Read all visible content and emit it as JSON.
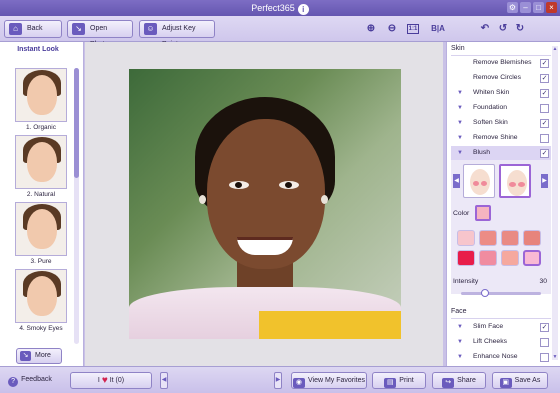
{
  "app": {
    "title": "Perfect365"
  },
  "toolbar": {
    "back_label": "Back",
    "open_label": "Open Photo",
    "adjust_label": "Adjust Key Points",
    "ba_label": "B|A"
  },
  "left_panel": {
    "title": "Instant Look",
    "looks": [
      {
        "label": "1. Organic"
      },
      {
        "label": "2. Natural"
      },
      {
        "label": "3. Pure"
      },
      {
        "label": "4. Smoky Eyes"
      }
    ],
    "more_label": "More"
  },
  "right_panel": {
    "skin_title": "Skin",
    "skin_items": [
      {
        "label": "Remove Blemishes",
        "checked": true,
        "expandable": false
      },
      {
        "label": "Remove Circles",
        "checked": true,
        "expandable": false
      },
      {
        "label": "Whiten Skin",
        "checked": true,
        "expandable": true
      },
      {
        "label": "Foundation",
        "checked": false,
        "expandable": true
      },
      {
        "label": "Soften Skin",
        "checked": true,
        "expandable": true
      },
      {
        "label": "Remove Shine",
        "checked": false,
        "expandable": true
      },
      {
        "label": "Blush",
        "checked": true,
        "expandable": true
      }
    ],
    "blush": {
      "color_label": "Color",
      "intensity_label": "Intensity",
      "intensity_value": "30",
      "intensity_fraction": 0.3,
      "selected_color": "#f5b4c0",
      "swatches": [
        "#f7c5cc",
        "#ec8c86",
        "#e98a84",
        "#e7847c",
        "#e81d4a",
        "#f08ca0",
        "#f5a89e",
        "#f9b9d4"
      ],
      "selected_swatch": 7,
      "selected_style": 1
    },
    "face_title": "Face",
    "face_items": [
      {
        "label": "Slim Face",
        "checked": true
      },
      {
        "label": "Lift Cheeks",
        "checked": false
      },
      {
        "label": "Enhance Nose",
        "checked": false
      }
    ]
  },
  "bottom": {
    "feedback_label": "Feedback",
    "like_prefix": "I",
    "like_suffix": "It (0)",
    "favorites_label": "View My Favorites",
    "print_label": "Print",
    "share_label": "Share",
    "save_label": "Save As"
  },
  "colors": {
    "accent": "#6a5bbd",
    "titlebar": "#6456b0",
    "panel_bg": "#c9c1e6"
  }
}
